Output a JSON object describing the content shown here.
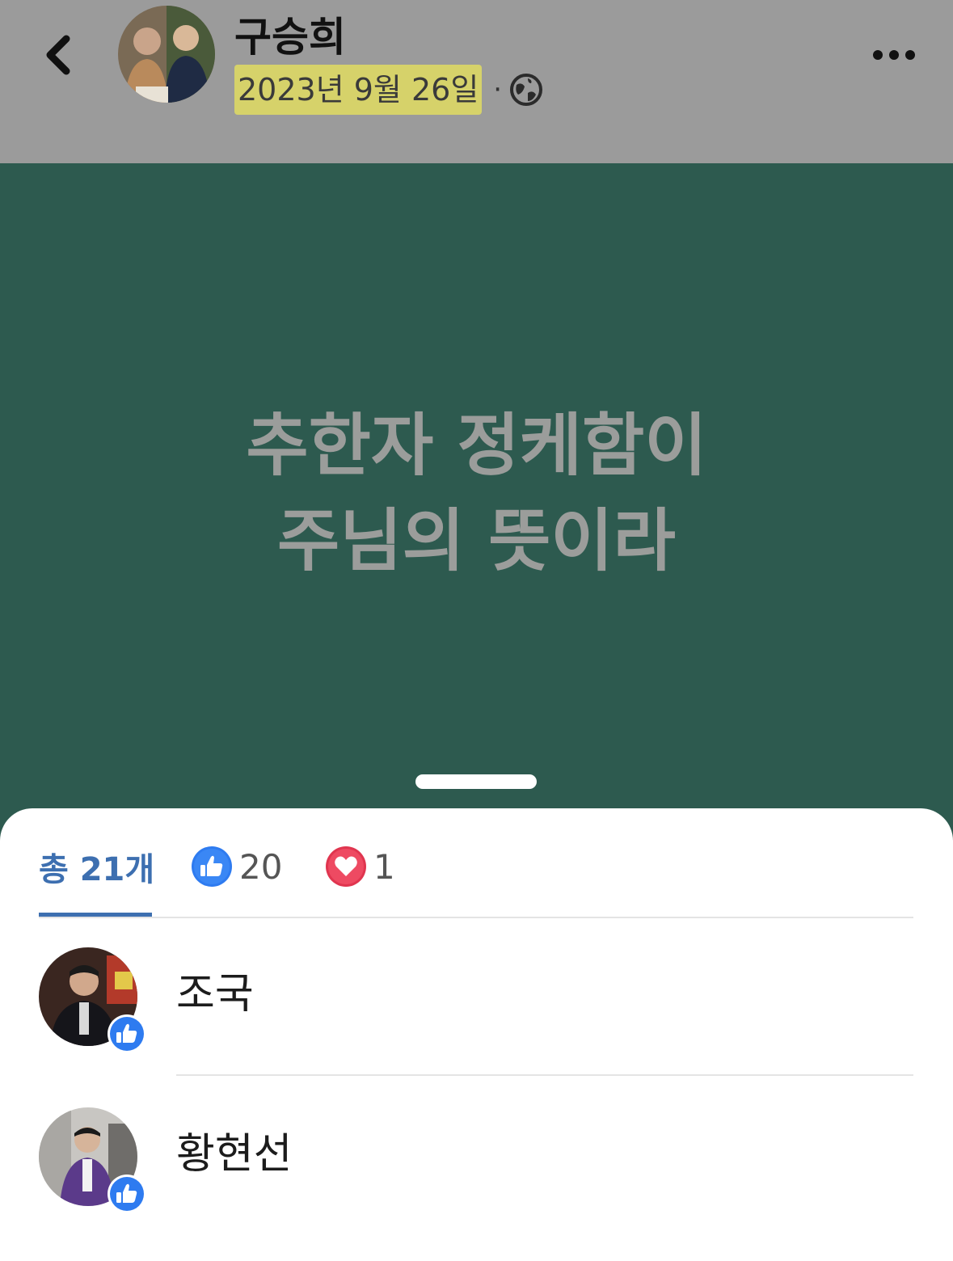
{
  "header": {
    "author_name": "구승희",
    "post_date": "2023년 9월 26일",
    "separator": "·",
    "privacy_icon": "globe-icon",
    "back_icon": "chevron-left-icon",
    "more_icon": "more-horizontal-icon"
  },
  "post": {
    "text_lines": [
      "추한자 정케함이",
      "주님의 뜻이라"
    ],
    "background_color": "#2d5a4f",
    "text_color": "#9b9d9b"
  },
  "reactions": {
    "tabs": [
      {
        "label": "총 21개",
        "selected": true
      },
      {
        "icon": "like-icon",
        "count": "20"
      },
      {
        "icon": "love-icon",
        "count": "1"
      }
    ],
    "accent_color": "#3d6fb0",
    "users": [
      {
        "name": "조국",
        "reaction": "like-icon"
      },
      {
        "name": "황현선",
        "reaction": "like-icon"
      }
    ]
  }
}
